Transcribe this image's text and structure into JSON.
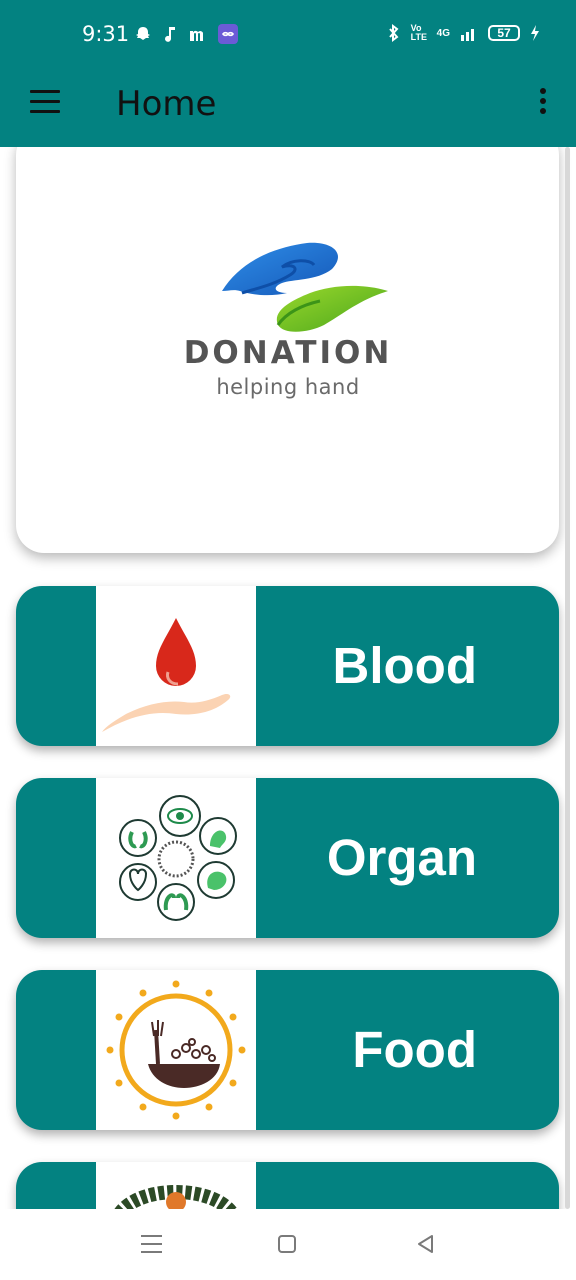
{
  "status_bar": {
    "time": "9:31",
    "network": "4G",
    "lte": "Vo LTE",
    "battery": "57"
  },
  "app_bar": {
    "title": "Home"
  },
  "banner": {
    "logo_title": "DONATION",
    "logo_subtitle": "helping hand"
  },
  "categories": [
    {
      "label": "Blood",
      "icon": "blood-drop-hand-icon"
    },
    {
      "label": "Organ",
      "icon": "organs-icon"
    },
    {
      "label": "Food",
      "icon": "food-bowl-icon"
    }
  ],
  "colors": {
    "primary": "#038281",
    "card_text": "#ffffff"
  },
  "nav_bar": {
    "icons": [
      "recents-icon",
      "home-icon",
      "back-icon"
    ]
  }
}
